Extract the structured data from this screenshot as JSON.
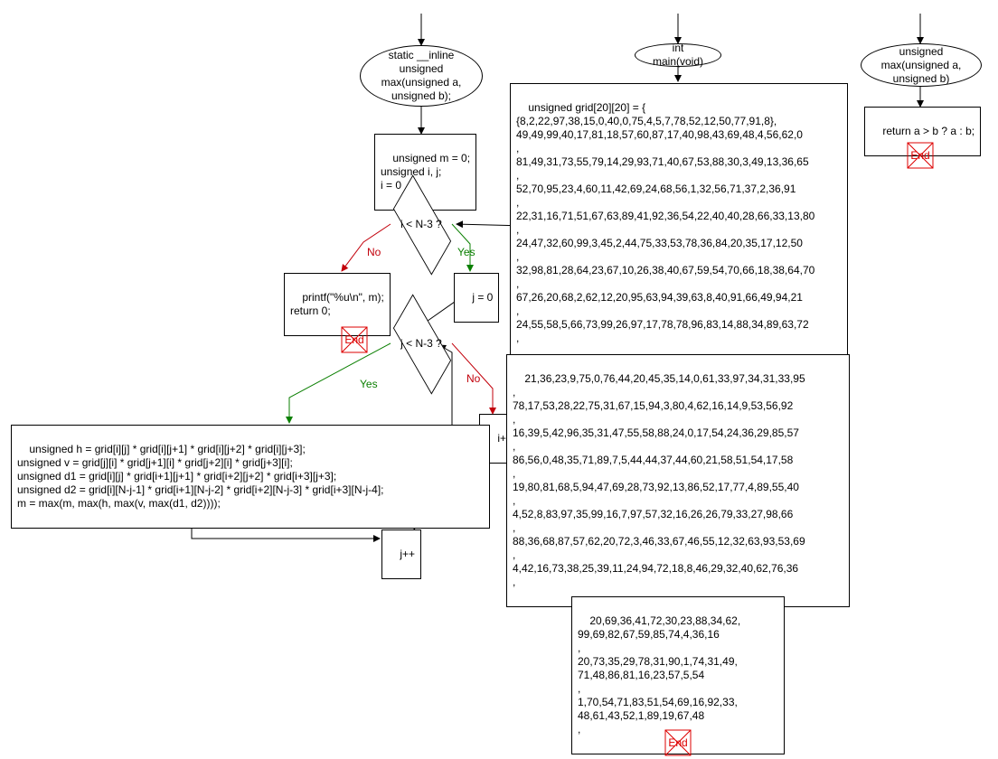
{
  "labels": {
    "yes": "Yes",
    "no": "No",
    "end": "End"
  },
  "left": {
    "funcsig": "static __inline unsigned\nmax(unsigned\na, unsigned b);",
    "init": "unsigned m = 0;\nunsigned i, j;\ni = 0",
    "cond_i": "i < N-3 ?",
    "print": "printf(\"%u\\n\", m);\nreturn 0;",
    "jinit": "j = 0",
    "cond_j": "j < N-3 ?",
    "ipp": "i++",
    "body": "unsigned h = grid[i][j] * grid[i][j+1] * grid[i][j+2] * grid[i][j+3];\nunsigned v = grid[j][i] * grid[j+1][i] * grid[j+2][i] * grid[j+3][i];\nunsigned d1 = grid[i][j] * grid[i+1][j+1] * grid[i+2][j+2] * grid[i+3][j+3];\nunsigned d2 = grid[i][N-j-1] * grid[i+1][N-j-2] * grid[i+2][N-j-3] * grid[i+3][N-j-4];\nm = max(m, max(h, max(v, max(d1, d2))));",
    "jpp": "j++"
  },
  "mid": {
    "funcsig": "int main(void)",
    "block1": "unsigned grid[20][20] = {\n{8,2,22,97,38,15,0,40,0,75,4,5,7,78,52,12,50,77,91,8},\n49,49,99,40,17,81,18,57,60,87,17,40,98,43,69,48,4,56,62,0\n,\n81,49,31,73,55,79,14,29,93,71,40,67,53,88,30,3,49,13,36,65\n,\n52,70,95,23,4,60,11,42,69,24,68,56,1,32,56,71,37,2,36,91\n,\n22,31,16,71,51,67,63,89,41,92,36,54,22,40,40,28,66,33,13,80\n,\n24,47,32,60,99,3,45,2,44,75,33,53,78,36,84,20,35,17,12,50\n,\n32,98,81,28,64,23,67,10,26,38,40,67,59,54,70,66,18,38,64,70\n,\n67,26,20,68,2,62,12,20,95,63,94,39,63,8,40,91,66,49,94,21\n,\n24,55,58,5,66,73,99,26,97,17,78,78,96,83,14,88,34,89,63,72\n,",
    "block2": "21,36,23,9,75,0,76,44,20,45,35,14,0,61,33,97,34,31,33,95\n,\n78,17,53,28,22,75,31,67,15,94,3,80,4,62,16,14,9,53,56,92\n,\n16,39,5,42,96,35,31,47,55,58,88,24,0,17,54,24,36,29,85,57\n,\n86,56,0,48,35,71,89,7,5,44,44,37,44,60,21,58,51,54,17,58\n,\n19,80,81,68,5,94,47,69,28,73,92,13,86,52,17,77,4,89,55,40\n,\n4,52,8,83,97,35,99,16,7,97,57,32,16,26,26,79,33,27,98,66\n,\n88,36,68,87,57,62,20,72,3,46,33,67,46,55,12,32,63,93,53,69\n,\n4,42,16,73,38,25,39,11,24,94,72,18,8,46,29,32,40,62,76,36\n,",
    "block3": "20,69,36,41,72,30,23,88,34,62,\n99,69,82,67,59,85,74,4,36,16\n,\n20,73,35,29,78,31,90,1,74,31,49,\n71,48,86,81,16,23,57,5,54\n,\n1,70,54,71,83,51,54,69,16,92,33,\n48,61,43,52,1,89,19,67,48\n,"
  },
  "right": {
    "funcsig": "unsigned max(unsigned\na, unsigned b)",
    "ret": "return a > b ? a : b;"
  },
  "colors": {
    "yes": "#0a7f00",
    "no": "#c2000b",
    "end": "#d00"
  }
}
